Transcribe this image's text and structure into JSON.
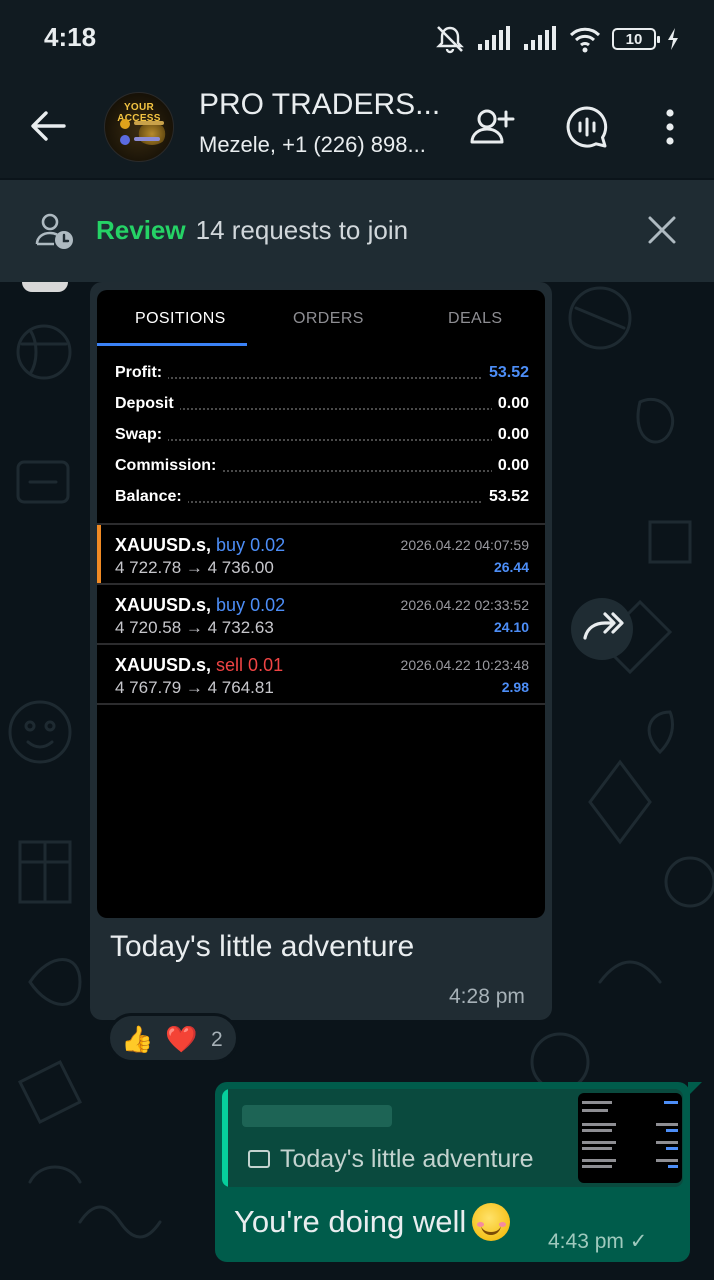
{
  "status_bar": {
    "time": "4:18",
    "battery": "10"
  },
  "header": {
    "group_name": "PRO TRADERS...",
    "members": "Mezele, +1 (226) 898...",
    "avatar_text": "YOUR ACCESS"
  },
  "banner": {
    "action": "Review",
    "text": "14 requests to join"
  },
  "message_in": {
    "tabs": [
      "POSITIONS",
      "ORDERS",
      "DEALS"
    ],
    "active_tab": "POSITIONS",
    "account": [
      {
        "label": "Profit:",
        "value": "53.52"
      },
      {
        "label": "Deposit",
        "value": "0.00"
      },
      {
        "label": "Swap:",
        "value": "0.00"
      },
      {
        "label": "Commission:",
        "value": "0.00"
      },
      {
        "label": "Balance:",
        "value": "53.52"
      }
    ],
    "trades": [
      {
        "symbol": "XAUUSD.s,",
        "side": "buy 0.02",
        "prices": "4 722.78 → 4 736.00",
        "time": "2026.04.22 04:07:59",
        "profit": "26.44"
      },
      {
        "symbol": "XAUUSD.s,",
        "side": "buy 0.02",
        "prices": "4 720.58 → 4 732.63",
        "time": "2026.04.22 02:33:52",
        "profit": "24.10"
      },
      {
        "symbol": "XAUUSD.s,",
        "side": "sell 0.01",
        "prices": "4 767.79 → 4 764.81",
        "time": "2026.04.22 10:23:48",
        "profit": "2.98"
      }
    ],
    "caption": "Today's little adventure",
    "time": "4:28 pm",
    "reaction_count": "2"
  },
  "message_out": {
    "quoted_text": "Today's little adventure",
    "text": "You're doing well",
    "time": "4:43 pm ✓"
  },
  "colors": {
    "accent_green": "#25d366",
    "bubble_out": "#005c4b",
    "bubble_in": "#202c33",
    "buy_blue": "#4d8ef7",
    "sell_red": "#ef4444"
  }
}
